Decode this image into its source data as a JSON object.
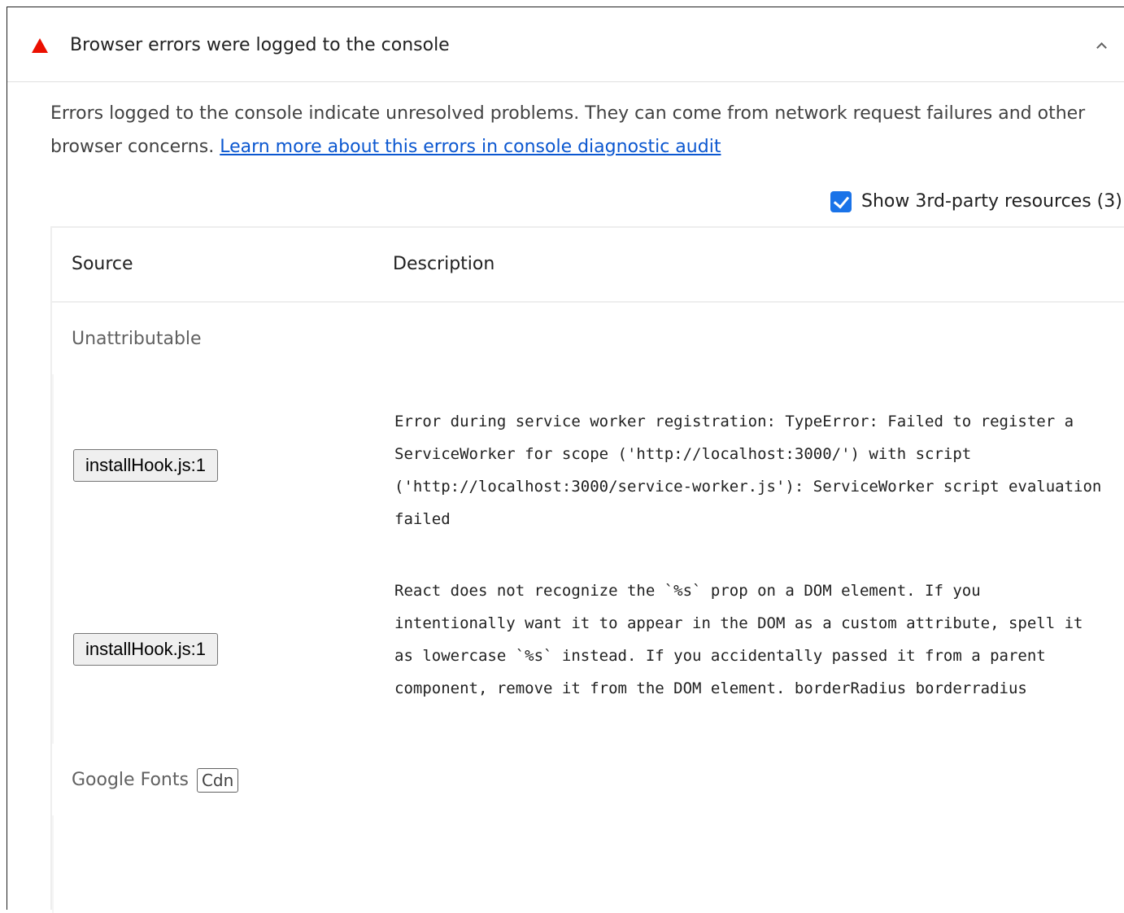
{
  "audit": {
    "title": "Browser errors were logged to the console",
    "status_icon": "fail-triangle-icon",
    "status_color": "#eb0f00",
    "expanded": true,
    "description": "Errors logged to the console indicate unresolved problems. They can come from network request failures and other browser concerns. ",
    "learn_more_link": "Learn more about this errors in console diagnostic audit"
  },
  "third_party_toggle": {
    "label": "Show 3rd-party resources (3)",
    "checked": true
  },
  "table": {
    "headers": {
      "source": "Source",
      "description": "Description"
    },
    "groups": [
      {
        "label": "Unattributable",
        "entity_chip": "",
        "rows": [
          {
            "source": "installHook.js:1",
            "description": "Error during service worker registration: TypeError: Failed to register a ServiceWorker for scope ('http://localhost:3000/') with script ('http://localhost:3000/service-worker.js'): ServiceWorker script evaluation failed"
          },
          {
            "source": "installHook.js:1",
            "description": "React does not recognize the `%s` prop on a DOM element. If you intentionally want it to appear in the DOM as a custom attribute, spell it as lowercase `%s` instead. If you accidentally passed it from a parent component, remove it from the DOM element. borderRadius borderradius"
          }
        ]
      },
      {
        "label": "Google Fonts",
        "entity_chip": "Cdn",
        "rows": []
      }
    ]
  }
}
